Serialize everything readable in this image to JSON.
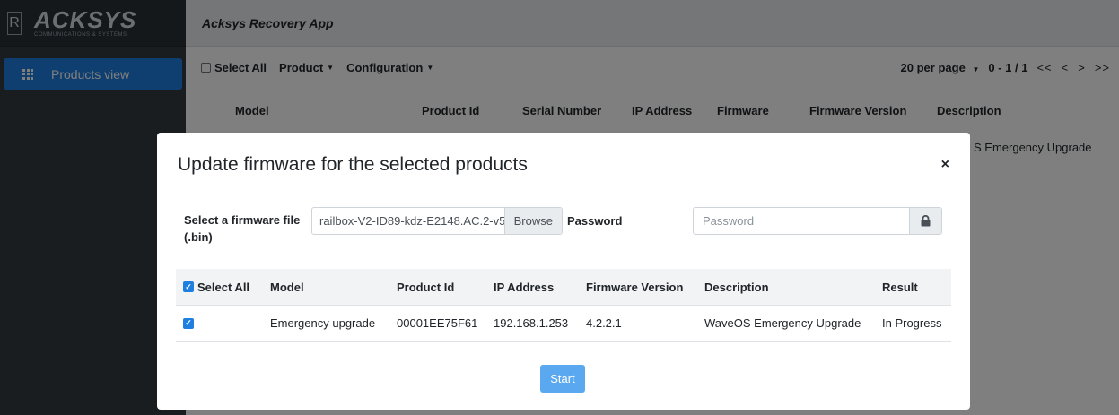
{
  "sidebar": {
    "brand_letter": "R",
    "brand_name": "ACKSYS",
    "brand_sub": "COMMUNICATIONS & SYSTEMS",
    "nav": [
      {
        "label": "Products view",
        "icon": "grid-icon"
      }
    ]
  },
  "header": {
    "title": "Acksys Recovery App"
  },
  "toolbar": {
    "select_all": "Select All",
    "product_menu": "Product",
    "configuration_menu": "Configuration",
    "per_page": "20 per page",
    "page_range": "0 - 1 / 1",
    "first_arrow": "<<",
    "prev_arrow": "<",
    "next_arrow": ">",
    "last_arrow": ">>"
  },
  "products_table": {
    "columns": [
      "Model",
      "Product Id",
      "Serial Number",
      "IP Address",
      "Firmware",
      "Firmware Version",
      "Description"
    ],
    "visible_row_fragment": "S Emergency Upgrade"
  },
  "modal": {
    "title": "Update firmware for the selected products",
    "close": "×",
    "file_label": "Select a firmware file (.bin)",
    "file_name": "railbox-V2-ID89-kdz-E2148.AC.2-v5",
    "browse": "Browse",
    "password_label": "Password",
    "password_placeholder": "Password",
    "table": {
      "columns": [
        "Select All",
        "Model",
        "Product Id",
        "IP Address",
        "Firmware Version",
        "Description",
        "Result"
      ],
      "rows": [
        {
          "checked": true,
          "model": "Emergency upgrade",
          "product_id": "00001EE75F61",
          "ip": "192.168.1.253",
          "firmware_version": "4.2.2.1",
          "description": "WaveOS Emergency Upgrade",
          "result": "In Progress"
        }
      ]
    },
    "start": "Start"
  },
  "colors": {
    "sidebar_bg": "#343a40",
    "accent": "#1f7fe0",
    "start_button": "#5aa9f0"
  }
}
